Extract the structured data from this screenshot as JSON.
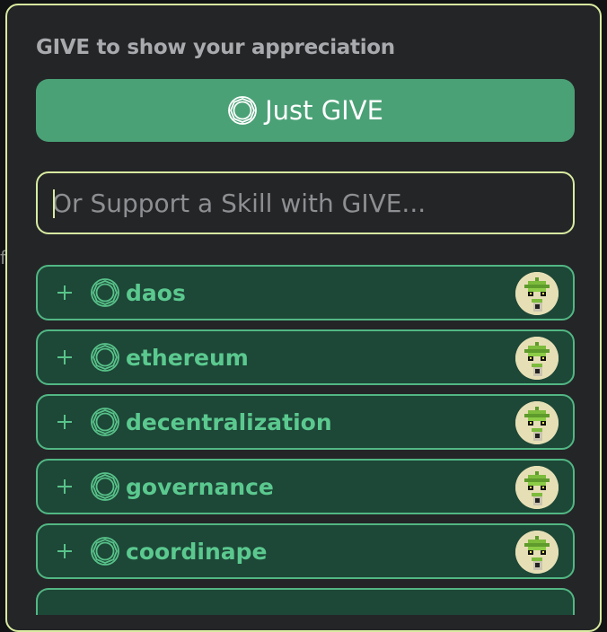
{
  "heading": "GIVE to show your appreciation",
  "just_give": {
    "label": "Just GIVE"
  },
  "search": {
    "placeholder": "Or Support a Skill with GIVE..."
  },
  "skills": [
    {
      "name": "daos"
    },
    {
      "name": "ethereum"
    },
    {
      "name": "decentralization"
    },
    {
      "name": "governance"
    },
    {
      "name": "coordinape"
    }
  ],
  "icons": {
    "give": "give-token-icon",
    "add": "plus-icon",
    "avatar": "pixel-plant-avatar"
  },
  "colors": {
    "accent_green": "#4aa176",
    "skill_text": "#5bc98f",
    "skill_bg": "#1d4737",
    "focus_border": "#d8eba0",
    "panel_bg": "#242527"
  }
}
